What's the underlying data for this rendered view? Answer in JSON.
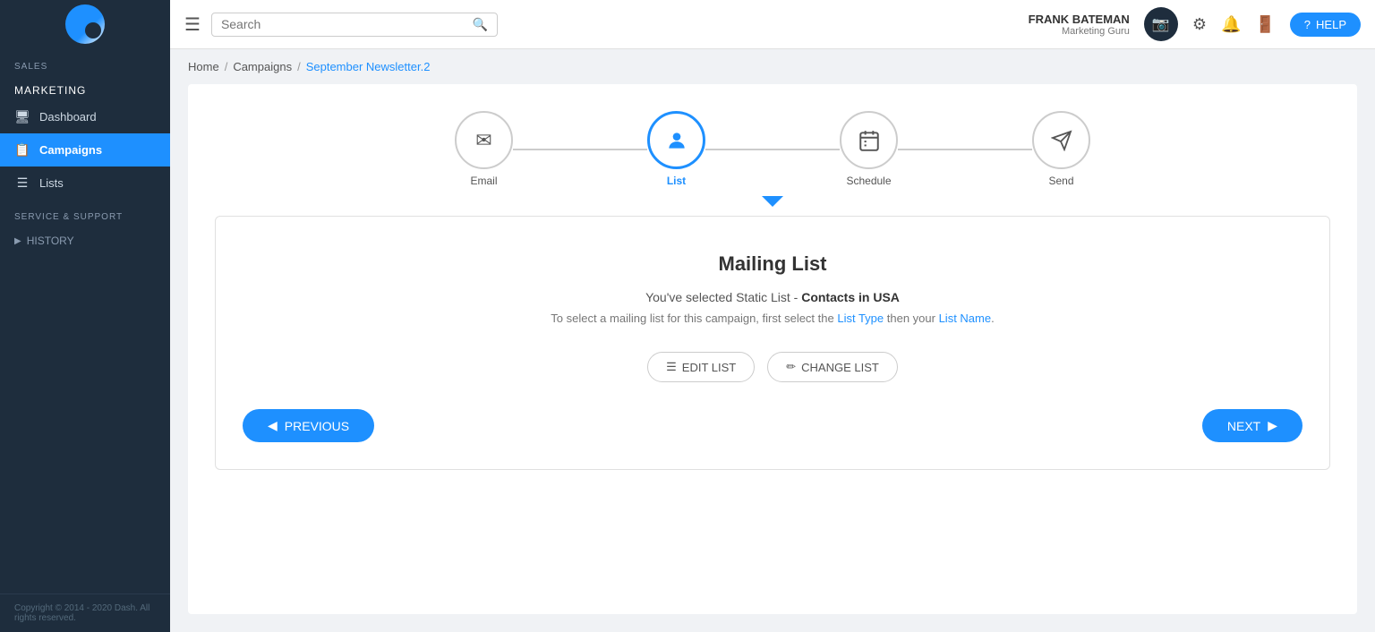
{
  "header": {
    "hamburger_label": "☰",
    "search_placeholder": "Search",
    "user_name": "FRANK BATEMAN",
    "user_role": "Marketing Guru",
    "camera_icon": "📷",
    "settings_icon": "⚙",
    "bell_icon": "🔔",
    "exit_icon": "🚪",
    "help_label": "HELP"
  },
  "sidebar": {
    "sales_label": "SALES",
    "marketing_label": "MARKETING",
    "dashboard_label": "Dashboard",
    "campaigns_label": "Campaigns",
    "lists_label": "Lists",
    "service_support_label": "SERVICE & SUPPORT",
    "history_label": "HISTORY",
    "footer_text": "Copyright © 2014 - 2020 Dash. All rights reserved."
  },
  "breadcrumb": {
    "home": "Home",
    "campaigns": "Campaigns",
    "current": "September Newsletter.2"
  },
  "steps": [
    {
      "icon": "✉",
      "label": "Email",
      "active": false
    },
    {
      "icon": "👤",
      "label": "List",
      "active": true
    },
    {
      "icon": "📅",
      "label": "Schedule",
      "active": false
    },
    {
      "icon": "➤",
      "label": "Send",
      "active": false
    }
  ],
  "mailing_list": {
    "title": "Mailing List",
    "subtitle_prefix": "You've selected Static List - ",
    "subtitle_bold": "Contacts in USA",
    "description_prefix": "To select a mailing list for this campaign, first select the ",
    "description_link1": "List Type",
    "description_middle": " then your ",
    "description_link2": "List Name",
    "description_suffix": ".",
    "edit_list_label": "EDIT LIST",
    "change_list_label": "CHANGE LIST",
    "previous_label": "PREVIOUS",
    "next_label": "NEXT"
  }
}
